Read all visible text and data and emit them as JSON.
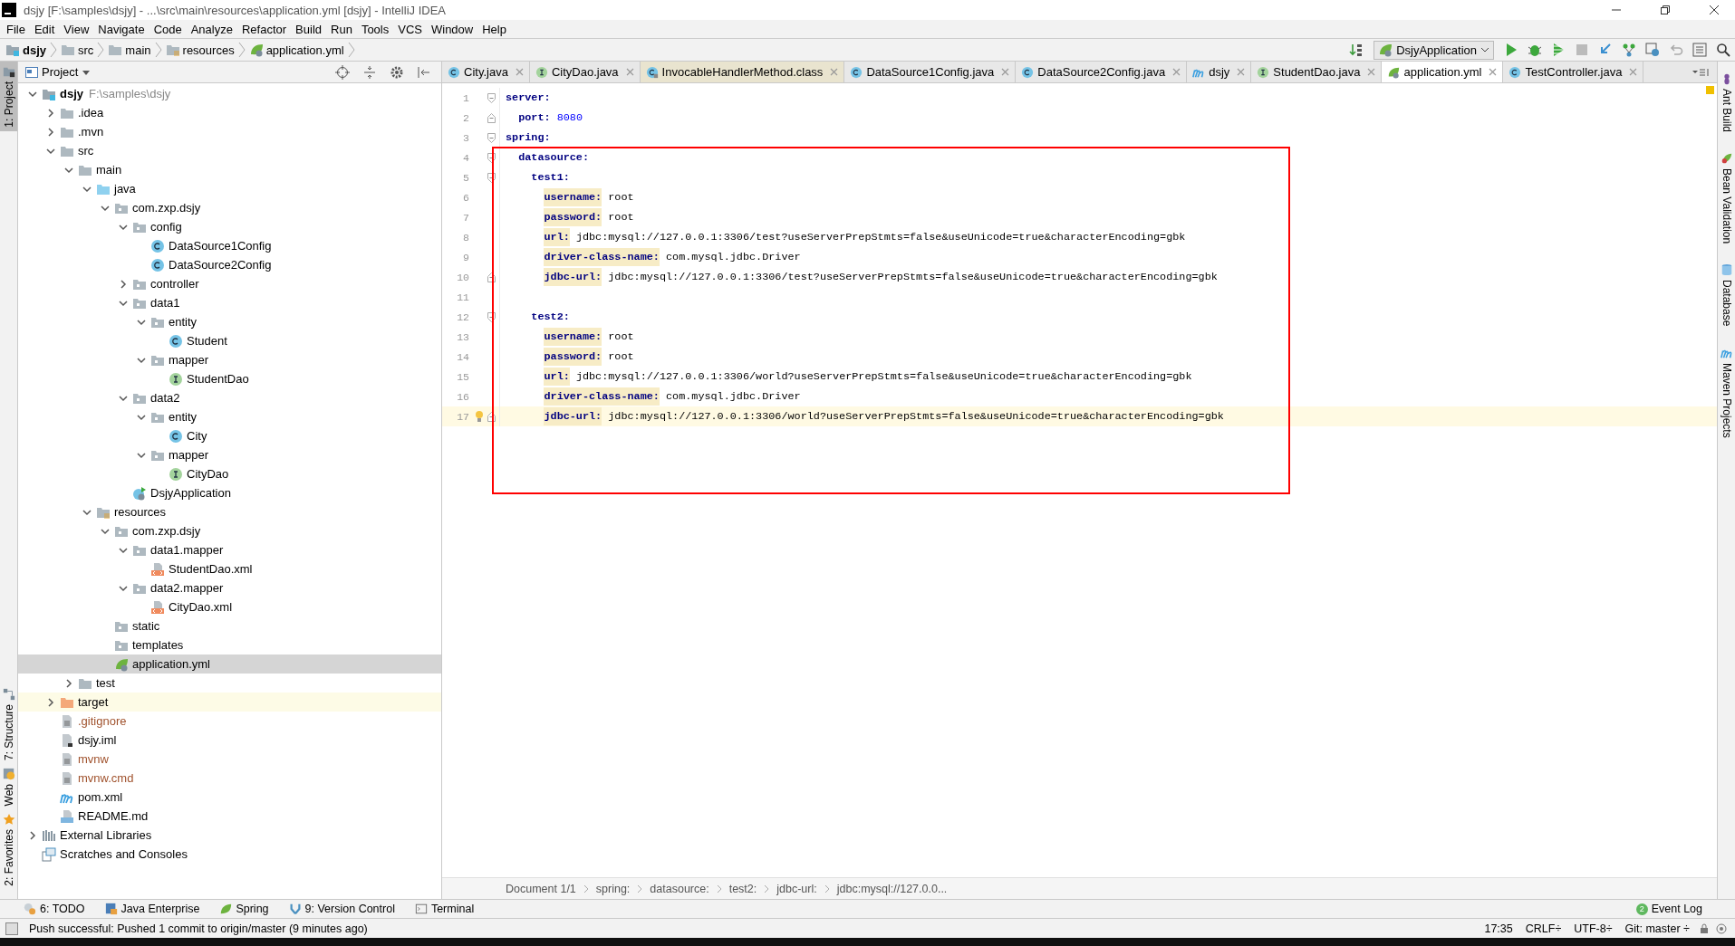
{
  "window": {
    "title": "dsjy [F:\\samples\\dsjy] - ...\\src\\main\\resources\\application.yml [dsjy] - IntelliJ IDEA"
  },
  "menu": [
    "File",
    "Edit",
    "View",
    "Navigate",
    "Code",
    "Analyze",
    "Refactor",
    "Build",
    "Run",
    "Tools",
    "VCS",
    "Window",
    "Help"
  ],
  "nav_bar": {
    "crumbs": [
      {
        "label": "dsjy",
        "kind": "module"
      },
      {
        "label": "src",
        "kind": "folder"
      },
      {
        "label": "main",
        "kind": "folder"
      },
      {
        "label": "resources",
        "kind": "resource-folder"
      },
      {
        "label": "application.yml",
        "kind": "spring-config"
      }
    ],
    "run_config": "DsjyApplication"
  },
  "left_stripe": [
    {
      "label": "1: Project",
      "kind": "project",
      "selected": true
    },
    {
      "label": "7: Structure",
      "kind": "structure",
      "selected": false
    },
    {
      "label": "Web",
      "kind": "web",
      "selected": false
    },
    {
      "label": "2: Favorites",
      "kind": "favorites",
      "selected": false
    }
  ],
  "project": {
    "title": "Project",
    "tree": [
      {
        "label": "dsjy",
        "path": "F:\\samples\\dsjy",
        "kind": "module",
        "expanded": true,
        "selected": false,
        "children": [
          {
            "label": ".idea",
            "kind": "folder",
            "expanded": false,
            "selected": false
          },
          {
            "label": ".mvn",
            "kind": "folder",
            "expanded": false,
            "selected": false
          },
          {
            "label": "src",
            "kind": "folder",
            "expanded": true,
            "selected": false,
            "children": [
              {
                "label": "main",
                "kind": "folder",
                "expanded": true,
                "selected": false,
                "children": [
                  {
                    "label": "java",
                    "kind": "source-folder",
                    "expanded": true,
                    "selected": false,
                    "children": [
                      {
                        "label": "com.zxp.dsjy",
                        "kind": "package",
                        "expanded": true,
                        "selected": false,
                        "children": [
                          {
                            "label": "config",
                            "kind": "package",
                            "expanded": true,
                            "selected": false,
                            "children": [
                              {
                                "label": "DataSource1Config",
                                "kind": "class",
                                "selected": false
                              },
                              {
                                "label": "DataSource2Config",
                                "kind": "class",
                                "selected": false
                              }
                            ]
                          },
                          {
                            "label": "controller",
                            "kind": "package",
                            "expanded": false,
                            "selected": false
                          },
                          {
                            "label": "data1",
                            "kind": "package",
                            "expanded": true,
                            "selected": false,
                            "children": [
                              {
                                "label": "entity",
                                "kind": "package",
                                "expanded": true,
                                "selected": false,
                                "children": [
                                  {
                                    "label": "Student",
                                    "kind": "class",
                                    "selected": false
                                  }
                                ]
                              },
                              {
                                "label": "mapper",
                                "kind": "package",
                                "expanded": true,
                                "selected": false,
                                "children": [
                                  {
                                    "label": "StudentDao",
                                    "kind": "interface",
                                    "selected": false
                                  }
                                ]
                              }
                            ]
                          },
                          {
                            "label": "data2",
                            "kind": "package",
                            "expanded": true,
                            "selected": false,
                            "children": [
                              {
                                "label": "entity",
                                "kind": "package",
                                "expanded": true,
                                "selected": false,
                                "children": [
                                  {
                                    "label": "City",
                                    "kind": "class",
                                    "selected": false
                                  }
                                ]
                              },
                              {
                                "label": "mapper",
                                "kind": "package",
                                "expanded": true,
                                "selected": false,
                                "children": [
                                  {
                                    "label": "CityDao",
                                    "kind": "interface",
                                    "selected": false
                                  }
                                ]
                              }
                            ]
                          },
                          {
                            "label": "DsjyApplication",
                            "kind": "spring-boot",
                            "selected": false
                          }
                        ]
                      }
                    ]
                  },
                  {
                    "label": "resources",
                    "kind": "resource-folder",
                    "expanded": true,
                    "selected": false,
                    "children": [
                      {
                        "label": "com.zxp.dsjy",
                        "kind": "package",
                        "expanded": true,
                        "selected": false,
                        "children": [
                          {
                            "label": "data1.mapper",
                            "kind": "package",
                            "expanded": true,
                            "selected": false,
                            "children": [
                              {
                                "label": "StudentDao.xml",
                                "kind": "xml",
                                "selected": false
                              }
                            ]
                          },
                          {
                            "label": "data2.mapper",
                            "kind": "package",
                            "expanded": true,
                            "selected": false,
                            "children": [
                              {
                                "label": "CityDao.xml",
                                "kind": "xml",
                                "selected": false
                              }
                            ]
                          }
                        ]
                      },
                      {
                        "label": "static",
                        "kind": "package",
                        "selected": false
                      },
                      {
                        "label": "templates",
                        "kind": "package",
                        "selected": false
                      },
                      {
                        "label": "application.yml",
                        "kind": "spring-config",
                        "selected": true
                      }
                    ]
                  }
                ]
              },
              {
                "label": "test",
                "kind": "folder",
                "expanded": false,
                "selected": false
              }
            ]
          },
          {
            "label": "target",
            "kind": "excluded-folder",
            "expanded": false,
            "selected": false
          },
          {
            "label": ".gitignore",
            "kind": "text-file",
            "unversioned": true,
            "selected": false
          },
          {
            "label": "dsjy.iml",
            "kind": "iml",
            "unversioned": false,
            "selected": false
          },
          {
            "label": "mvnw",
            "kind": "text-file",
            "unversioned": true,
            "selected": false
          },
          {
            "label": "mvnw.cmd",
            "kind": "text-file",
            "unversioned": true,
            "selected": false
          },
          {
            "label": "pom.xml",
            "kind": "maven",
            "unversioned": false,
            "selected": false
          },
          {
            "label": "README.md",
            "kind": "markdown",
            "unversioned": false,
            "selected": false
          }
        ]
      },
      {
        "label": "External Libraries",
        "kind": "libraries",
        "expanded": false,
        "selected": false
      },
      {
        "label": "Scratches and Consoles",
        "kind": "scratches",
        "selected": false
      }
    ]
  },
  "tabs": [
    {
      "label": "City.java",
      "kind": "class",
      "selected": false
    },
    {
      "label": "CityDao.java",
      "kind": "interface",
      "selected": false
    },
    {
      "label": "InvocableHandlerMethod.class",
      "kind": "class-file",
      "selected": false
    },
    {
      "label": "DataSource1Config.java",
      "kind": "class",
      "selected": false
    },
    {
      "label": "DataSource2Config.java",
      "kind": "class",
      "selected": false
    },
    {
      "label": "dsjy",
      "kind": "maven",
      "selected": false
    },
    {
      "label": "StudentDao.java",
      "kind": "interface",
      "selected": false
    },
    {
      "label": "application.yml",
      "kind": "spring-config",
      "selected": true
    },
    {
      "label": "TestController.java",
      "kind": "class",
      "selected": false
    }
  ],
  "editor": {
    "lines": [
      {
        "number": "1",
        "key": "server:",
        "current": false,
        "children": [
          {
            "number": "2",
            "key": "port:",
            "value": "8080",
            "kind": "number",
            "current": false
          }
        ]
      },
      {
        "number": "3",
        "key": "spring:",
        "current": false,
        "children": [
          {
            "number": "4",
            "key": "datasource:",
            "current": false,
            "children": [
              {
                "number": "5",
                "key": "test1:",
                "current": false,
                "children": [
                  {
                    "number": "6",
                    "key": "username:",
                    "value": "root",
                    "kind": "text",
                    "marked": true,
                    "current": false
                  },
                  {
                    "number": "7",
                    "key": "password:",
                    "value": "root",
                    "kind": "text",
                    "marked": true,
                    "current": false
                  },
                  {
                    "number": "8",
                    "key": "url:",
                    "value": "jdbc:mysql://127.0.0.1:3306/test?useServerPrepStmts=false&useUnicode=true&characterEncoding=gbk",
                    "kind": "text",
                    "marked": true,
                    "current": false
                  },
                  {
                    "number": "9",
                    "key": "driver-class-name:",
                    "value": "com.mysql.jdbc.Driver",
                    "kind": "text",
                    "marked": true,
                    "current": false
                  },
                  {
                    "number": "10",
                    "key": "jdbc-url:",
                    "value": "jdbc:mysql://127.0.0.1:3306/test?useServerPrepStmts=false&useUnicode=true&characterEncoding=gbk",
                    "kind": "text",
                    "marked": true,
                    "current": false
                  }
                ]
              },
              {
                "number": "11",
                "current": false
              },
              {
                "number": "12",
                "key": "test2:",
                "current": false,
                "children": [
                  {
                    "number": "13",
                    "key": "username:",
                    "value": "root",
                    "kind": "text",
                    "marked": true,
                    "current": false
                  },
                  {
                    "number": "14",
                    "key": "password:",
                    "value": "root",
                    "kind": "text",
                    "marked": true,
                    "current": false
                  },
                  {
                    "number": "15",
                    "key": "url:",
                    "value": "jdbc:mysql://127.0.0.1:3306/world?useServerPrepStmts=false&useUnicode=true&characterEncoding=gbk",
                    "kind": "text",
                    "marked": true,
                    "current": false
                  },
                  {
                    "number": "16",
                    "key": "driver-class-name:",
                    "value": "com.mysql.jdbc.Driver",
                    "kind": "text",
                    "marked": true,
                    "current": false
                  },
                  {
                    "number": "17",
                    "key": "jdbc-url:",
                    "value": "jdbc:mysql://127.0.0.1:3306/world?useServerPrepStmts=false&useUnicode=true&characterEncoding=gbk",
                    "kind": "text",
                    "marked": true,
                    "current": true,
                    "intention": true
                  }
                ]
              }
            ]
          }
        ]
      }
    ],
    "breadcrumbs": [
      "Document 1/1",
      "spring:",
      "datasource:",
      "test2:",
      "jdbc-url:",
      "jdbc:mysql://127.0.0..."
    ]
  },
  "right_stripe": [
    {
      "label": "Ant Build",
      "kind": "ant"
    },
    {
      "label": "Bean Validation",
      "kind": "bean"
    },
    {
      "label": "Database",
      "kind": "database"
    },
    {
      "label": "Maven Projects",
      "kind": "maven"
    }
  ],
  "tool_tabs": [
    {
      "label": "6: TODO",
      "kind": "todo"
    },
    {
      "label": "Java Enterprise",
      "kind": "javaee"
    },
    {
      "label": "Spring",
      "kind": "spring"
    },
    {
      "label": "9: Version Control",
      "kind": "vcs"
    },
    {
      "label": "Terminal",
      "kind": "terminal"
    }
  ],
  "event_log": {
    "label": "Event Log",
    "count": "2"
  },
  "status_bar": {
    "message": "Push successful: Pushed 1 commit to origin/master (9 minutes ago)",
    "position": "17:35",
    "line_separator": "CRLF÷",
    "encoding": "UTF-8÷",
    "vcs": "Git: master ÷"
  }
}
